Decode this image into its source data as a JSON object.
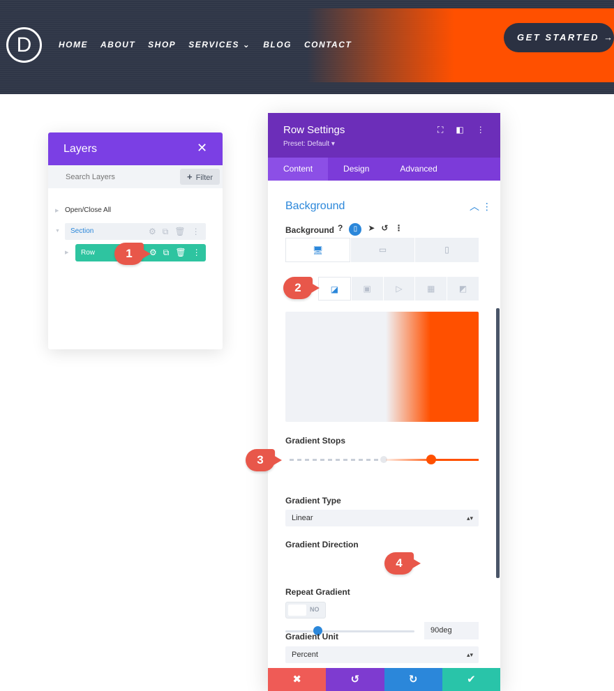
{
  "header": {
    "logo_letter": "D",
    "nav": [
      "HOME",
      "ABOUT",
      "SHOP",
      "SERVICES ⌄",
      "BLOG",
      "CONTACT"
    ],
    "cta_label": "GET STARTED →",
    "colors": {
      "bar": "#2f3647",
      "accent": "#ff5000"
    }
  },
  "layers": {
    "title": "Layers",
    "close_icon": "✕",
    "search_placeholder": "Search Layers",
    "filter_label": "Filter",
    "open_close_label": "Open/Close All",
    "section_label": "Section",
    "row_label": "Row"
  },
  "badges": [
    "1",
    "2",
    "3",
    "4"
  ],
  "modal": {
    "title": "Row Settings",
    "preset": "Preset: Default ▾",
    "tabs": [
      "Content",
      "Design",
      "Advanced"
    ],
    "section_title": "Background",
    "background_label": "Background",
    "gradient_stops_label": "Gradient Stops",
    "gradient_type_label": "Gradient Type",
    "gradient_type_value": "Linear",
    "gradient_direction_label": "Gradient Direction",
    "gradient_direction_value": "90deg",
    "repeat_gradient_label": "Repeat Gradient",
    "repeat_gradient_value": "NO",
    "gradient_unit_label": "Gradient Unit",
    "gradient_unit_value": "Percent",
    "colors": {
      "header": "#6c2eb9",
      "tabs": "#7c3bd9",
      "accent": "#2b87da",
      "gradient_end": "#ff5000"
    },
    "footer": {
      "cancel": "✖",
      "undo": "↺",
      "redo": "↻",
      "save": "✔",
      "colors": [
        "#ef5b56",
        "#7e3bd0",
        "#2b87da",
        "#29c4a9"
      ]
    }
  }
}
